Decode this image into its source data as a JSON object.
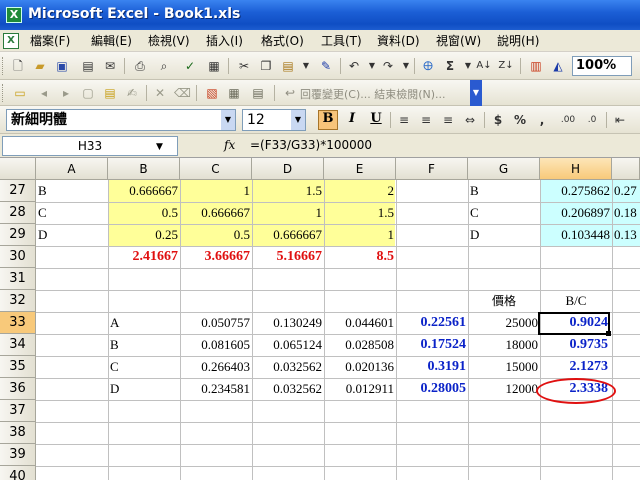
{
  "window": {
    "title": "Microsoft Excel - Book1.xls",
    "app_icon": "X"
  },
  "menu": {
    "items": [
      "檔案(F)",
      "編輯(E)",
      "檢視(V)",
      "插入(I)",
      "格式(O)",
      "工具(T)",
      "資料(D)",
      "視窗(W)",
      "說明(H)"
    ]
  },
  "toolbar": {
    "zoom": "100%",
    "review_label": "回覆變更(C)... 結束檢閱(N)...",
    "font_name": "新細明體",
    "font_size": "12",
    "bold": "B",
    "italic": "I",
    "underline": "U",
    "currency": "$",
    "percent": "%",
    "comma": ",",
    "sum": "Σ"
  },
  "formula_bar": {
    "name_box": "H33",
    "fx": "fx",
    "formula": "=(F33/G33)*100000"
  },
  "sheet": {
    "columns": [
      "A",
      "B",
      "C",
      "D",
      "E",
      "F",
      "G",
      "H",
      ""
    ],
    "selected_column": "H",
    "rows": [
      "27",
      "28",
      "29",
      "30",
      "31",
      "32",
      "33",
      "34",
      "35",
      "36",
      "37",
      "38",
      "39",
      "40"
    ],
    "selected_row": "33",
    "colors": {
      "yellow_fill": "#ffff99",
      "blue_fill": "#ccffff",
      "red_text": "#e01010",
      "blue_text": "#0a22c8",
      "selection": "#f8c97a"
    },
    "r27": {
      "a": "B",
      "b": "0.666667",
      "c": "1",
      "d": "1.5",
      "e": "2",
      "g": "B",
      "h": "0.275862",
      "i": "0.27"
    },
    "r28": {
      "a": "C",
      "b": "0.5",
      "c": "0.666667",
      "d": "1",
      "e": "1.5",
      "g": "C",
      "h": "0.206897",
      "i": "0.18"
    },
    "r29": {
      "a": "D",
      "b": "0.25",
      "c": "0.5",
      "d": "0.666667",
      "e": "1",
      "g": "D",
      "h": "0.103448",
      "i": "0.13"
    },
    "r30": {
      "b": "2.41667",
      "c": "3.66667",
      "d": "5.16667",
      "e": "8.5"
    },
    "r32": {
      "g": "價格",
      "h": "B/C"
    },
    "r33": {
      "b": "A",
      "c": "0.050757",
      "d": "0.130249",
      "e": "0.044601",
      "f": "0.22561",
      "g": "25000",
      "h": "0.9024"
    },
    "r34": {
      "b": "B",
      "c": "0.081605",
      "d": "0.065124",
      "e": "0.028508",
      "f": "0.17524",
      "g": "18000",
      "h": "0.9735"
    },
    "r35": {
      "b": "C",
      "c": "0.266403",
      "d": "0.032562",
      "e": "0.020136",
      "f": "0.3191",
      "g": "15000",
      "h": "2.1273"
    },
    "r36": {
      "b": "D",
      "c": "0.234581",
      "d": "0.032562",
      "e": "0.012911",
      "f": "0.28005",
      "g": "12000",
      "h": "2.3338"
    }
  }
}
